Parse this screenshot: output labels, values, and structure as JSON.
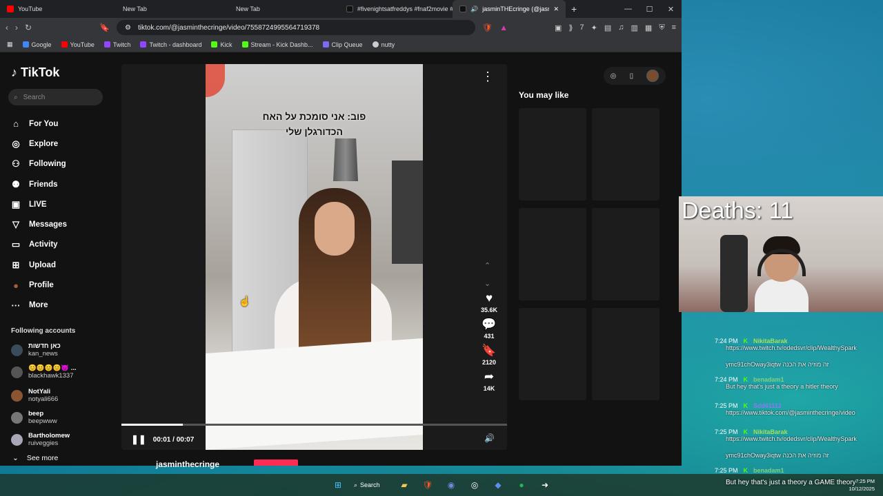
{
  "browser": {
    "tabs": [
      {
        "title": "YouTube",
        "color": "#ff0000",
        "active": false
      },
      {
        "title": "New Tab",
        "color": "#444444",
        "active": false
      },
      {
        "title": "New Tab",
        "color": "#444444",
        "active": false
      },
      {
        "title": "#fivenightsatfreddys #fnaf2movie #fr",
        "color": "#111111",
        "active": false
      },
      {
        "title": "jasminTHEcringe (@jasminthe",
        "color": "#111111",
        "active": true
      }
    ],
    "url": "tiktok.com/@jasminthecringe/video/7558724995564719378",
    "bookmarks": [
      "Google",
      "YouTube",
      "Twitch",
      "Twitch - dashboard",
      "Kick",
      "Stream - Kick Dashb...",
      "Clip Queue",
      "nutty"
    ]
  },
  "tiktok": {
    "logo": "TikTok",
    "search_placeholder": "Search",
    "nav": [
      {
        "label": "For You",
        "icon": "home-icon"
      },
      {
        "label": "Explore",
        "icon": "compass-icon"
      },
      {
        "label": "Following",
        "icon": "following-icon"
      },
      {
        "label": "Friends",
        "icon": "friends-icon"
      },
      {
        "label": "LIVE",
        "icon": "live-icon"
      },
      {
        "label": "Messages",
        "icon": "messages-icon"
      },
      {
        "label": "Activity",
        "icon": "activity-icon"
      },
      {
        "label": "Upload",
        "icon": "upload-icon"
      },
      {
        "label": "Profile",
        "icon": "profile-icon"
      },
      {
        "label": "More",
        "icon": "more-icon"
      }
    ],
    "following_title": "Following accounts",
    "following": [
      {
        "name": "כאן חדשות",
        "handle": "kan_news"
      },
      {
        "name": "😊😊😊😊😈 ...",
        "handle": "blackhawk1337"
      },
      {
        "name": "NotYali",
        "handle": "notyali666"
      },
      {
        "name": "beep",
        "handle": "beepwww"
      },
      {
        "name": "Bartholomew",
        "handle": "ruiveggies"
      }
    ],
    "see_more": "See more",
    "video": {
      "overlay_line1": "פוב: אני סומכת על האח",
      "overlay_line2": "הכדורגלן שלי",
      "time": "00:01 / 00:07",
      "progress": 0.16
    },
    "actions": [
      {
        "icon": "heart-icon",
        "count": "35.6K"
      },
      {
        "icon": "comment-icon",
        "count": "431"
      },
      {
        "icon": "bookmark-icon",
        "count": "2120"
      },
      {
        "icon": "share-icon",
        "count": "14K"
      }
    ],
    "creator_partial": "jasminthecringe",
    "may_like": "You may like"
  },
  "overlay": {
    "deaths": "Deaths: 11",
    "chat": [
      {
        "time": "7:24 PM",
        "user": "NikitaBarak",
        "text": "https://www.twitch.tv/odedsvr/clip/WealthySpark"
      },
      {
        "time": "",
        "user": "",
        "text": "ymc91chOway3iqtw זה מוזיה את הכנה"
      },
      {
        "time": "7:24 PM",
        "user": "benadam1",
        "text": "But hey that's just a theory a hitler theory"
      },
      {
        "time": "7:25 PM",
        "user": "Sdd61112",
        "text": "https://www.tiktok.com/@jasminthecringe/video"
      },
      {
        "time": "7:25 PM",
        "user": "NikitaBarak",
        "text": "https://www.twitch.tv/odedsvr/clip/WealthySpark"
      },
      {
        "time": "",
        "user": "",
        "text": "ymc91chOway3iqtw זה מוזיה את הכנה"
      },
      {
        "time": "7:25 PM",
        "user": "benadam1",
        "text": ""
      }
    ],
    "caption": "But hey that's just a theory a GAME theory"
  },
  "taskbar": {
    "search_label": "Search",
    "time": "7:25 PM",
    "date": "10/12/2025"
  }
}
